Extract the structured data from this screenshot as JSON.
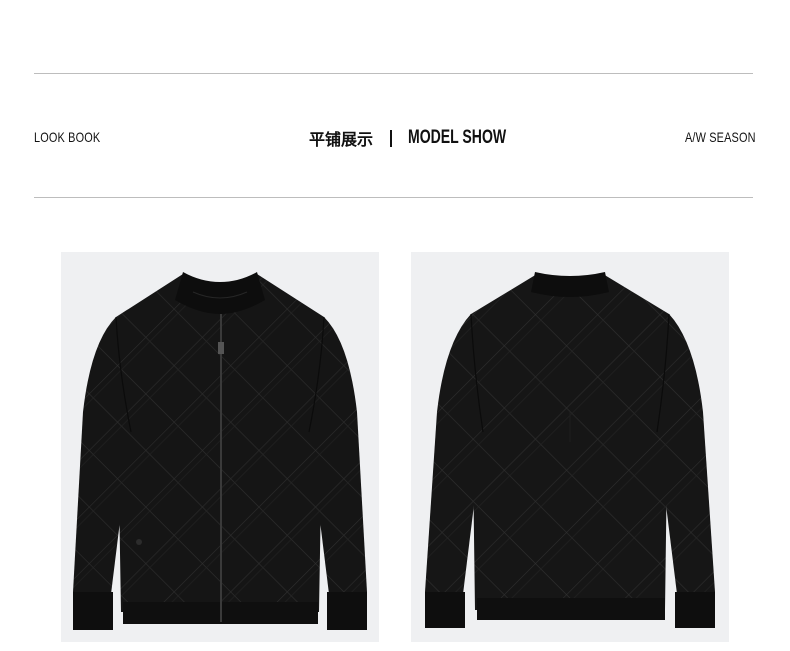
{
  "header": {
    "left_label": "LOOK BOOK",
    "title_cn": "平铺展示",
    "separator": "|",
    "title_en": "MODEL SHOW",
    "right_label": "A/W SEASON"
  },
  "photos": [
    {
      "name": "jacket-front-photo",
      "view": "front"
    },
    {
      "name": "jacket-back-photo",
      "view": "back"
    }
  ],
  "colors": {
    "background": "#ffffff",
    "divider": "#bdbdbd",
    "photo_bg": "#eff0f2",
    "jacket": "#141414",
    "text": "#111111"
  }
}
